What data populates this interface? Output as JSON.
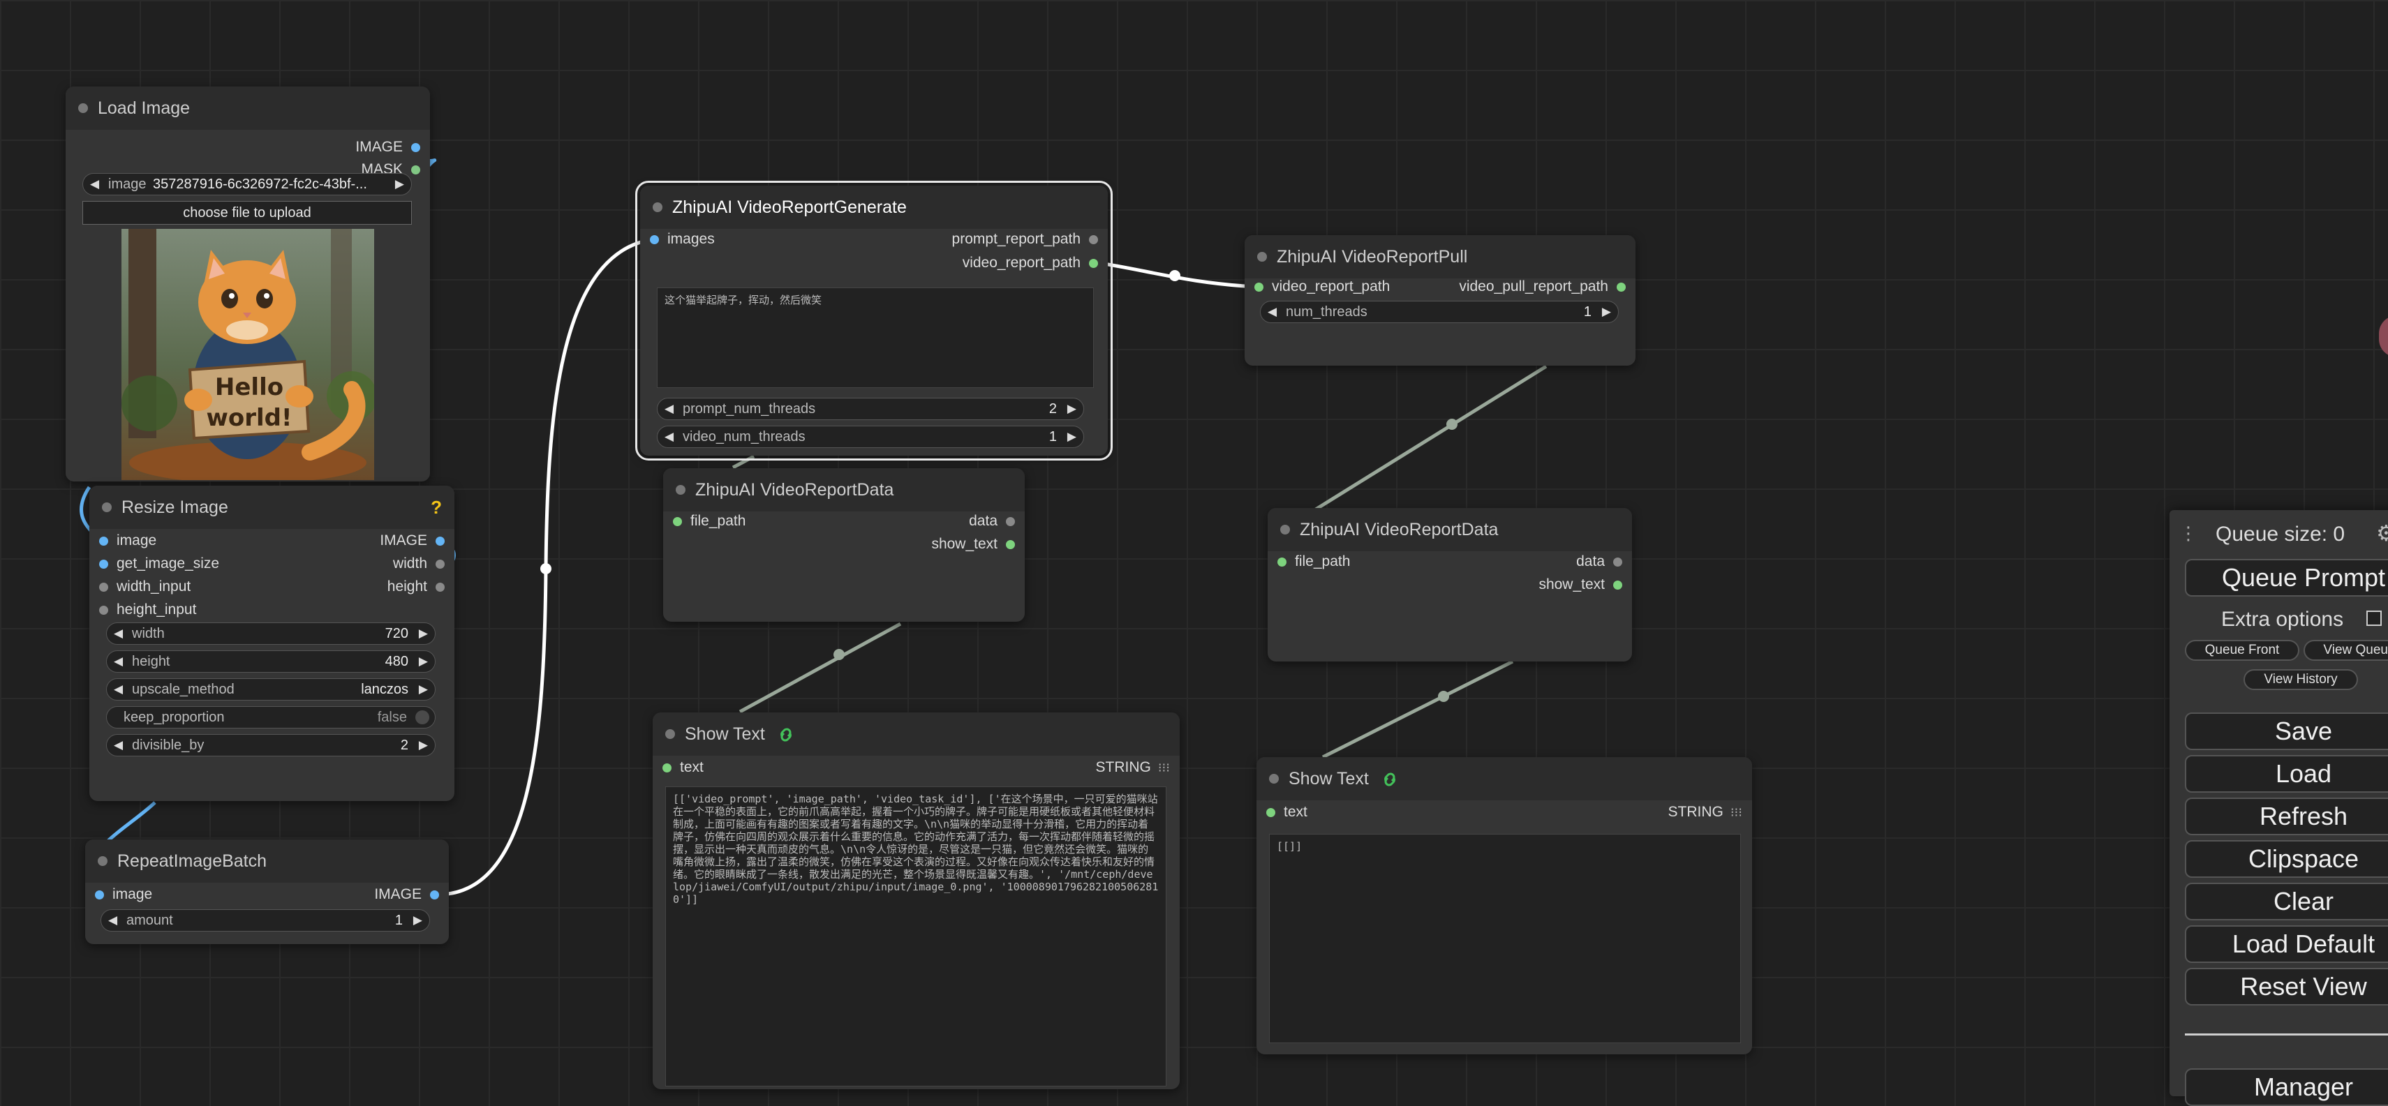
{
  "colors": {
    "canvas_bg": "#202020",
    "node_bg": "#353535",
    "node_title_bg": "#2c2c2c",
    "link_white": "#ffffff",
    "link_gray": "#9aa89a",
    "link_blue": "#64b5f6",
    "image_slot": "#64b5f6",
    "string_slot": "#7ed37e",
    "help_icon": "#f5c518"
  },
  "nodes": {
    "load_image": {
      "title": "Load Image",
      "outputs": [
        "IMAGE",
        "MASK"
      ],
      "image_widget": {
        "label": "image",
        "value": "357287916-6c326972-fc2c-43bf-..."
      },
      "upload_button": "choose file to upload",
      "preview_sign_text": "Hello world!",
      "preview_alt": "cat-holding-hello-world-sign"
    },
    "resize_image": {
      "title": "Resize Image",
      "help_icon": "?",
      "inputs": [
        "image",
        "get_image_size",
        "width_input",
        "height_input"
      ],
      "outputs": [
        "IMAGE",
        "width",
        "height"
      ],
      "widgets": [
        {
          "label": "width",
          "value": "720"
        },
        {
          "label": "height",
          "value": "480"
        },
        {
          "label": "upscale_method",
          "value": "lanczos"
        },
        {
          "label": "keep_proportion",
          "value": "false"
        },
        {
          "label": "divisible_by",
          "value": "2"
        }
      ]
    },
    "repeat_image_batch": {
      "title": "RepeatImageBatch",
      "inputs": [
        "image"
      ],
      "outputs": [
        "IMAGE"
      ],
      "widgets": [
        {
          "label": "amount",
          "value": "1"
        }
      ]
    },
    "video_report_generate": {
      "title": "ZhipuAI VideoReportGenerate",
      "inputs": [
        "images"
      ],
      "outputs": [
        "prompt_report_path",
        "video_report_path"
      ],
      "prompt_text": "这个猫举起牌子，挥动，然后微笑",
      "widgets": [
        {
          "label": "prompt_num_threads",
          "value": "2"
        },
        {
          "label": "video_num_threads",
          "value": "1"
        }
      ]
    },
    "video_report_data_1": {
      "title": "ZhipuAI VideoReportData",
      "inputs": [
        "file_path"
      ],
      "outputs": [
        "data",
        "show_text"
      ]
    },
    "show_text_1": {
      "title": "Show Text",
      "icon": "link-icon",
      "inputs": [
        "text"
      ],
      "outputs": [
        "STRING"
      ],
      "content": "[['video_prompt', 'image_path', 'video_task_id'], ['在这个场景中，一只可爱的猫咪站在一个平稳的表面上，它的前爪高高举起，握着一个小巧的牌子。牌子可能是用硬纸板或者其他轻便材料制成，上面可能画有有趣的图案或者写着有趣的文字。\\n\\n猫咪的举动显得十分滑稽，它用力的挥动着牌子，仿佛在向四周的观众展示着什么重要的信息。它的动作充满了活力，每一次挥动都伴随着轻微的摇摆，显示出一种天真而顽皮的气息。\\n\\n令人惊讶的是，尽管这是一只猫，但它竟然还会微笑。猫咪的嘴角微微上扬，露出了温柔的微笑，仿佛在享受这个表演的过程。又好像在向观众传达着快乐和友好的情绪。它的眼睛眯成了一条线，散发出满足的光芒，整个场景显得既温馨又有趣。', '/mnt/ceph/develop/jiawei/ComfyUI/output/zhipu/input/image_0.png', '1000089017962821005062810']]"
    },
    "video_report_pull": {
      "title": "ZhipuAI VideoReportPull",
      "inputs": [
        "video_report_path"
      ],
      "outputs": [
        "video_pull_report_path"
      ],
      "widgets": [
        {
          "label": "num_threads",
          "value": "1"
        }
      ]
    },
    "video_report_data_2": {
      "title": "ZhipuAI VideoReportData",
      "inputs": [
        "file_path"
      ],
      "outputs": [
        "data",
        "show_text"
      ]
    },
    "show_text_2": {
      "title": "Show Text",
      "icon": "link-icon",
      "inputs": [
        "text"
      ],
      "outputs": [
        "STRING"
      ],
      "content": "[[]]"
    }
  },
  "queue_panel": {
    "handle_icon": "drag-handle-icon",
    "queue_size_label": "Queue size: 0",
    "settings_icon": "gear-icon",
    "queue_prompt": "Queue Prompt",
    "extra_options": "Extra options",
    "queue_front": "Queue Front",
    "view_queue": "View Queue",
    "view_history": "View History",
    "buttons": [
      "Save",
      "Load",
      "Refresh",
      "Clipspace",
      "Clear",
      "Load Default",
      "Reset View"
    ],
    "partial_bottom": "Manager"
  }
}
